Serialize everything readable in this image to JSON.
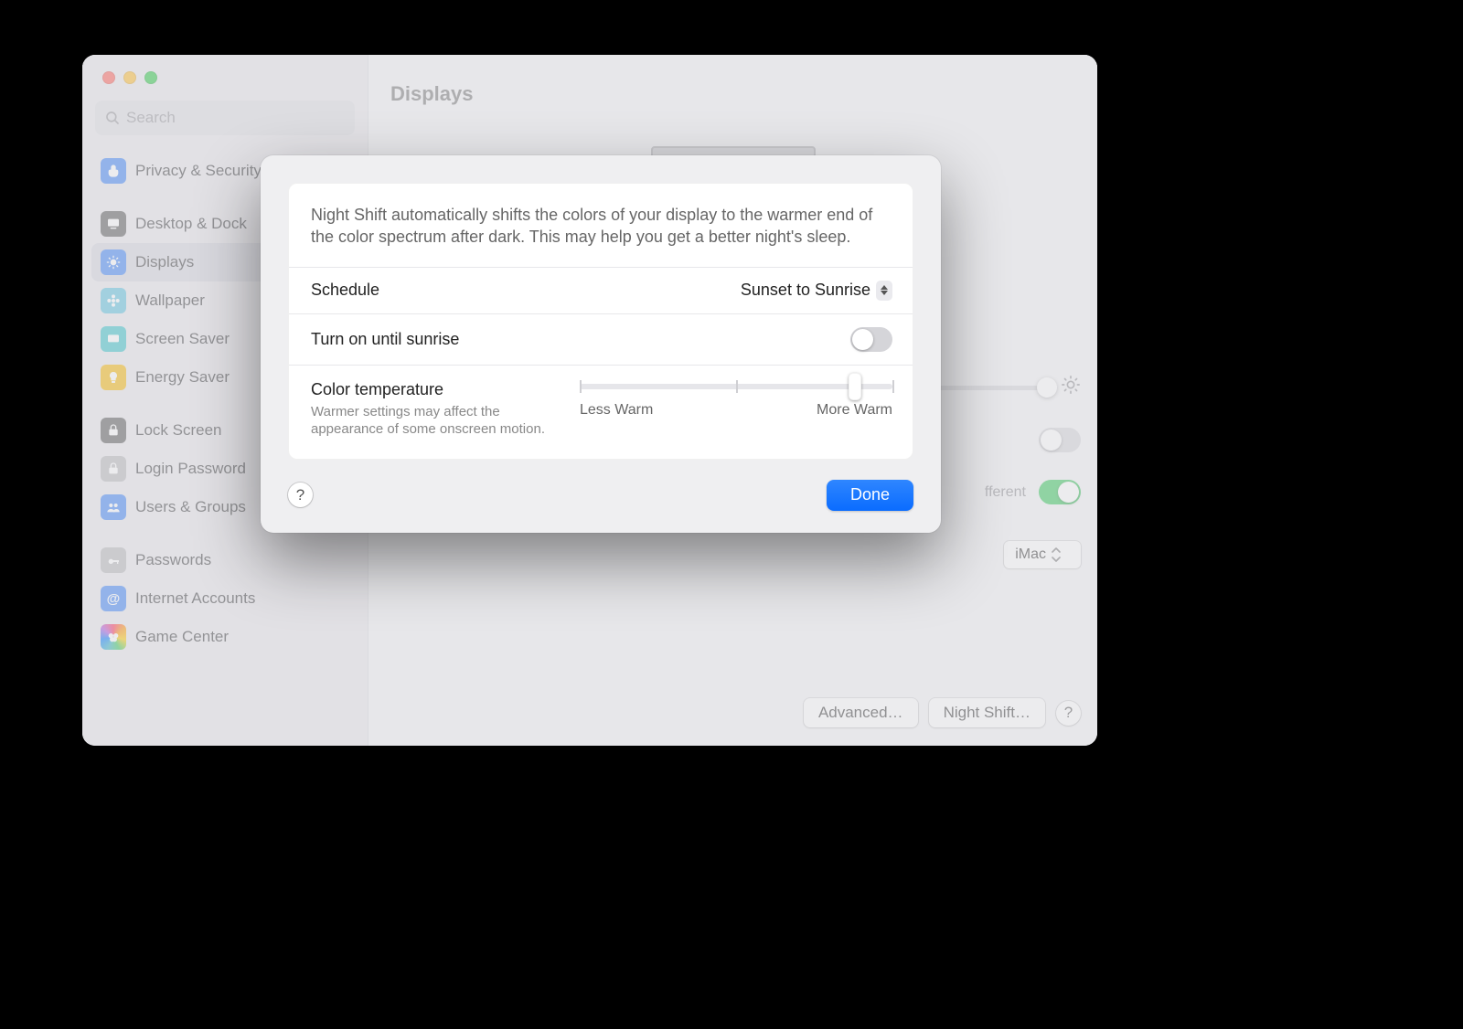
{
  "window": {
    "title": "Displays"
  },
  "search": {
    "placeholder": "Search"
  },
  "sidebar": {
    "items": [
      {
        "label": "Privacy & Security",
        "icon": "hand-icon",
        "cls": "bg-blue"
      },
      {
        "gap": true
      },
      {
        "label": "Desktop & Dock",
        "icon": "desktop-icon",
        "cls": "bg-dark"
      },
      {
        "label": "Displays",
        "icon": "sun-icon",
        "cls": "bg-blue",
        "selected": true
      },
      {
        "label": "Wallpaper",
        "icon": "flower-icon",
        "cls": "bg-cyan"
      },
      {
        "label": "Screen Saver",
        "icon": "screensaver-icon",
        "cls": "bg-teal"
      },
      {
        "label": "Energy Saver",
        "icon": "bulb-icon",
        "cls": "bg-yellow"
      },
      {
        "gap": true
      },
      {
        "label": "Lock Screen",
        "icon": "lock-icon",
        "cls": "bg-dark"
      },
      {
        "label": "Login Password",
        "icon": "lock-icon",
        "cls": "bg-lgray"
      },
      {
        "label": "Users & Groups",
        "icon": "users-icon",
        "cls": "bg-blue"
      },
      {
        "gap": true
      },
      {
        "label": "Passwords",
        "icon": "key-icon",
        "cls": "bg-lgray"
      },
      {
        "label": "Internet Accounts",
        "icon": "at-icon",
        "cls": "bg-blue"
      },
      {
        "label": "Game Center",
        "icon": "gc-icon",
        "cls": "bg-grad"
      }
    ]
  },
  "background": {
    "toggle_different_label": "fferent",
    "play_sound": {
      "label": "iMac"
    },
    "advanced_label": "Advanced…",
    "night_shift_label": "Night Shift…"
  },
  "sheet": {
    "description": "Night Shift automatically shifts the colors of your display to the warmer end of the color spectrum after dark. This may help you get a better night's sleep.",
    "schedule": {
      "label": "Schedule",
      "value": "Sunset to Sunrise"
    },
    "manual": {
      "label": "Turn on until sunrise",
      "on": false
    },
    "temperature": {
      "label": "Color temperature",
      "sub": "Warmer settings may affect the appearance of some onscreen motion.",
      "min_label": "Less Warm",
      "max_label": "More Warm",
      "value_pct": 88
    },
    "done_label": "Done"
  }
}
